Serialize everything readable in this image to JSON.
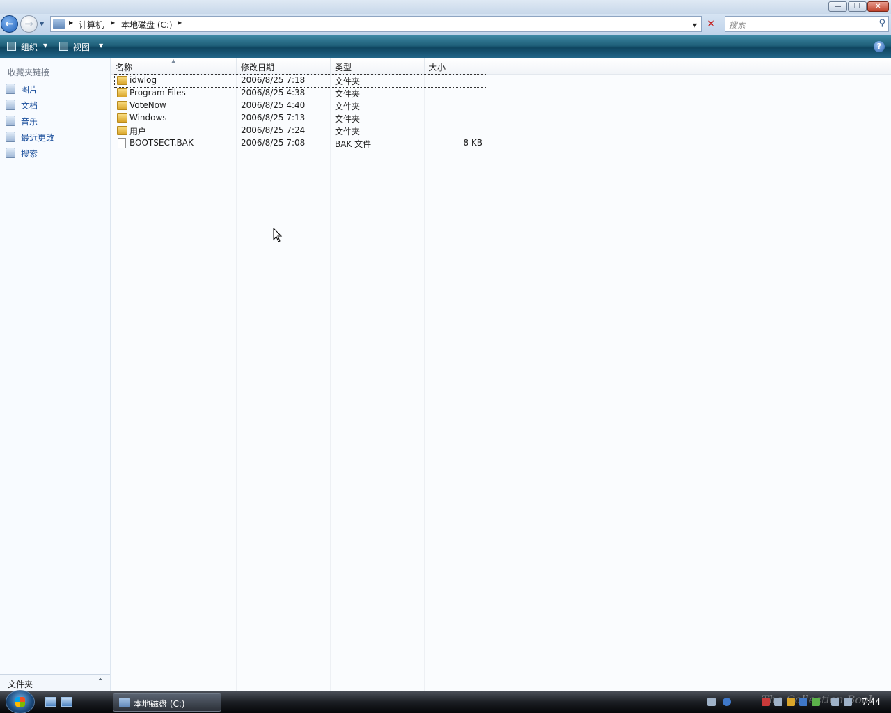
{
  "window": {
    "minimize_glyph": "—",
    "maximize_glyph": "❐",
    "close_glyph": "✕"
  },
  "address": {
    "crumbs": [
      "计算机",
      "本地磁盘 (C:)"
    ],
    "search_placeholder": "搜索"
  },
  "toolbar": {
    "organize_label": "组织",
    "views_label": "视图",
    "help_glyph": "?"
  },
  "navpane": {
    "heading": "收藏夹链接",
    "links": [
      "图片",
      "文档",
      "音乐",
      "最近更改",
      "搜索"
    ],
    "folders_label": "文件夹"
  },
  "columns": [
    "名称",
    "修改日期",
    "类型",
    "大小"
  ],
  "files": [
    {
      "name": "idwlog",
      "date": "2006/8/25 7:18",
      "type": "文件夹",
      "size": "",
      "kind": "folder"
    },
    {
      "name": "Program Files",
      "date": "2006/8/25 4:38",
      "type": "文件夹",
      "size": "",
      "kind": "folder"
    },
    {
      "name": "VoteNow",
      "date": "2006/8/25 4:40",
      "type": "文件夹",
      "size": "",
      "kind": "folder"
    },
    {
      "name": "Windows",
      "date": "2006/8/25 7:13",
      "type": "文件夹",
      "size": "",
      "kind": "folder"
    },
    {
      "name": "用户",
      "date": "2006/8/25 7:24",
      "type": "文件夹",
      "size": "",
      "kind": "folder"
    },
    {
      "name": "BOOTSECT.BAK",
      "date": "2006/8/25 7:08",
      "type": "BAK 文件",
      "size": "8 KB",
      "kind": "file"
    }
  ],
  "taskbar": {
    "active_window": "本地磁盘 (C:)",
    "clock": "7:44",
    "watermark": "The Collection Book"
  }
}
